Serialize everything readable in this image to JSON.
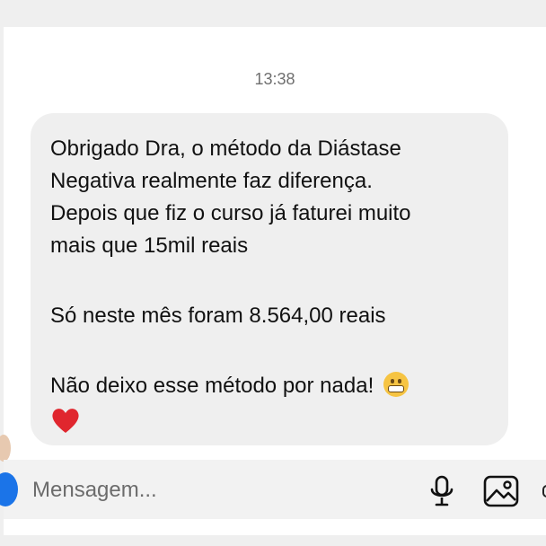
{
  "chat": {
    "timestamp": "13:38",
    "message": {
      "lines": [
        "Obrigado Dra, o método da Diástase",
        "Negativa realmente faz diferença.",
        "Depois que fiz o curso já faturei muito",
        "mais que 15mil reais"
      ],
      "line_sales": "Só neste mês foram 8.564,00 reais",
      "line_closing": "Não deixo esse método por nada!",
      "emojis": [
        "grimacing-face-icon",
        "red-heart-icon"
      ]
    }
  },
  "composer": {
    "placeholder": "Mensagem...",
    "icons": [
      "microphone-icon",
      "gallery-icon"
    ]
  },
  "colors": {
    "bubble": "#efefef",
    "heart": "#e0262e",
    "accent": "#1b74e8"
  }
}
